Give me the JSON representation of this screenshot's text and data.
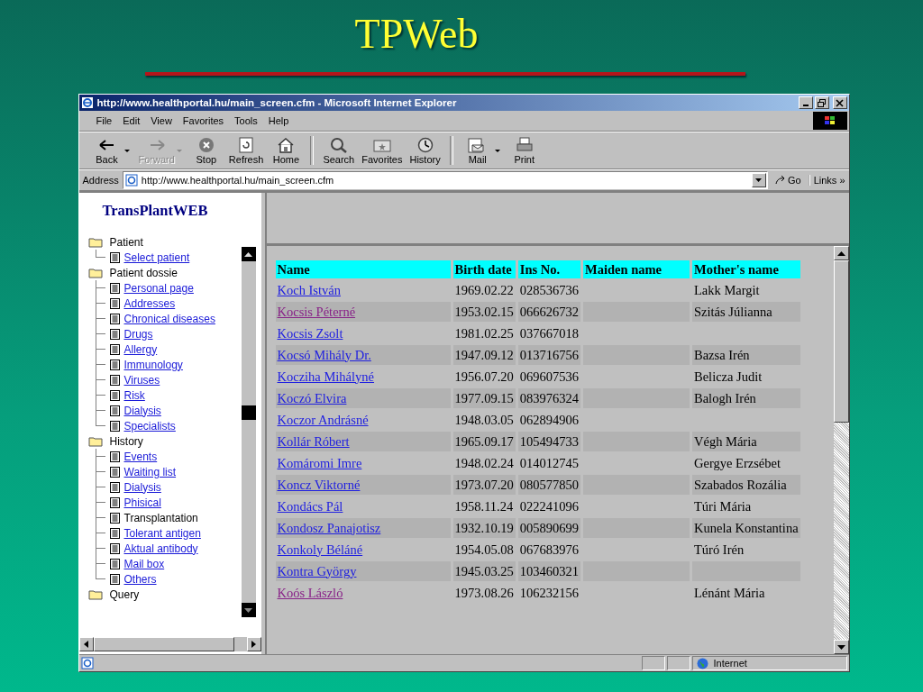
{
  "slide_title": "TPWeb",
  "window": {
    "title": "http://www.healthportal.hu/main_screen.cfm - Microsoft Internet Explorer"
  },
  "menu": [
    "File",
    "Edit",
    "View",
    "Favorites",
    "Tools",
    "Help"
  ],
  "toolbar": [
    {
      "kind": "back",
      "label": "Back",
      "dropdown": true,
      "disabled": false
    },
    {
      "kind": "forward",
      "label": "Forward",
      "dropdown": true,
      "disabled": true
    },
    {
      "kind": "stop",
      "label": "Stop",
      "dropdown": false,
      "disabled": false
    },
    {
      "kind": "refresh",
      "label": "Refresh",
      "dropdown": false,
      "disabled": false
    },
    {
      "kind": "home",
      "label": "Home",
      "dropdown": false,
      "disabled": false
    },
    {
      "kind": "search",
      "label": "Search",
      "dropdown": false,
      "disabled": false
    },
    {
      "kind": "favorites",
      "label": "Favorites",
      "dropdown": false,
      "disabled": false
    },
    {
      "kind": "history",
      "label": "History",
      "dropdown": false,
      "disabled": false
    },
    {
      "kind": "mail",
      "label": "Mail",
      "dropdown": true,
      "disabled": false
    },
    {
      "kind": "print",
      "label": "Print",
      "dropdown": false,
      "disabled": false
    }
  ],
  "address": {
    "label": "Address",
    "url": "http://www.healthportal.hu/main_screen.cfm",
    "go": "Go",
    "links": "Links »"
  },
  "sidebar": {
    "title": "TransPlantWEB",
    "tree": [
      {
        "label": "Patient",
        "children": [
          {
            "label": "Select patient",
            "kind": "link"
          }
        ]
      },
      {
        "label": "Patient dossie",
        "children": [
          {
            "label": "Personal page",
            "kind": "link"
          },
          {
            "label": "Addresses",
            "kind": "link"
          },
          {
            "label": "Chronical diseases",
            "kind": "link"
          },
          {
            "label": "Drugs",
            "kind": "link"
          },
          {
            "label": "Allergy",
            "kind": "link"
          },
          {
            "label": "Immunology",
            "kind": "link"
          },
          {
            "label": "Viruses",
            "kind": "link"
          },
          {
            "label": "Risk",
            "kind": "link"
          },
          {
            "label": "Dialysis",
            "kind": "link"
          },
          {
            "label": "Specialists",
            "kind": "link"
          }
        ]
      },
      {
        "label": "History",
        "children": [
          {
            "label": "Events",
            "kind": "link"
          },
          {
            "label": "Waiting list",
            "kind": "link"
          },
          {
            "label": "Dialysis",
            "kind": "link"
          },
          {
            "label": "Phisical",
            "kind": "link"
          },
          {
            "label": "Transplantation",
            "kind": "text"
          },
          {
            "label": "Tolerant antigen",
            "kind": "link"
          },
          {
            "label": "Aktual antibody",
            "kind": "link"
          },
          {
            "label": "Mail box",
            "kind": "link"
          },
          {
            "label": "Others",
            "kind": "link"
          }
        ]
      },
      {
        "label": "Query"
      }
    ]
  },
  "table": {
    "columns": [
      "Name",
      "Birth date",
      "Ins No.",
      "Maiden name",
      "Mother's name"
    ],
    "rows": [
      {
        "name": "Koch István",
        "visited": false,
        "birth_date": "1969.02.22",
        "ins_no": "028536736",
        "mother": "Lakk Margit"
      },
      {
        "name": "Kocsis Péterné",
        "visited": true,
        "birth_date": "1953.02.15",
        "ins_no": "066626732",
        "mother": "Szitás Júlianna"
      },
      {
        "name": "Kocsis Zsolt",
        "visited": false,
        "birth_date": "1981.02.25",
        "ins_no": "037667018"
      },
      {
        "name": "Kocsó Mihály Dr.",
        "visited": false,
        "birth_date": "1947.09.12",
        "ins_no": "013716756",
        "mother": "Bazsa Irén"
      },
      {
        "name": "Kocziha Mihályné",
        "visited": false,
        "birth_date": "1956.07.20",
        "ins_no": "069607536",
        "mother": "Belicza Judit"
      },
      {
        "name": "Koczó Elvira",
        "visited": false,
        "birth_date": "1977.09.15",
        "ins_no": "083976324",
        "mother": "Balogh Irén"
      },
      {
        "name": "Koczor Andrásné",
        "visited": false,
        "birth_date": "1948.03.05",
        "ins_no": "062894906"
      },
      {
        "name": "Kollár Róbert",
        "visited": false,
        "birth_date": "1965.09.17",
        "ins_no": "105494733",
        "mother": "Végh Mária"
      },
      {
        "name": "Komáromi Imre",
        "visited": false,
        "birth_date": "1948.02.24",
        "ins_no": "014012745",
        "mother": "Gergye Erzsébet"
      },
      {
        "name": "Koncz Viktorné",
        "visited": false,
        "birth_date": "1973.07.20",
        "ins_no": "080577850",
        "mother": "Szabados Rozália"
      },
      {
        "name": "Kondács Pál",
        "visited": false,
        "birth_date": "1958.11.24",
        "ins_no": "022241096",
        "mother": "Túri Mária"
      },
      {
        "name": "Kondosz Panajotisz",
        "visited": false,
        "birth_date": "1932.10.19",
        "ins_no": "005890699",
        "mother": "Kunela Konstantina"
      },
      {
        "name": "Konkoly Béláné",
        "visited": false,
        "birth_date": "1954.05.08",
        "ins_no": "067683976",
        "mother": "Túró Irén"
      },
      {
        "name": "Kontra György",
        "visited": false,
        "birth_date": "1945.03.25",
        "ins_no": "103460321"
      },
      {
        "name": "Koós László",
        "visited": true,
        "birth_date": "1973.08.26",
        "ins_no": "106232156",
        "mother": "Lénánt Mária"
      }
    ]
  },
  "status_bar": {
    "zone": "Internet"
  }
}
